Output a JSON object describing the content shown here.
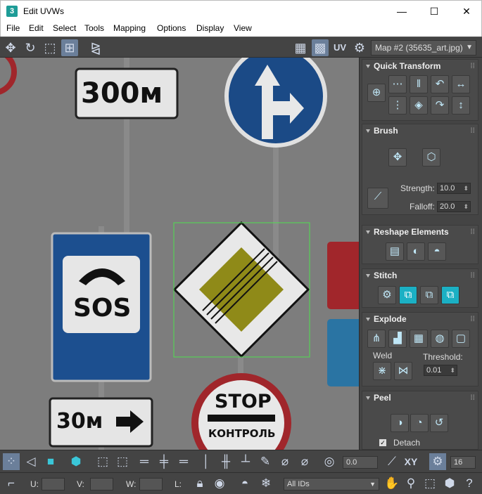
{
  "window": {
    "app_icon": "3",
    "title": "Edit UVWs",
    "minimize": "—",
    "maximize": "☐",
    "close": "✕"
  },
  "menu": [
    "File",
    "Edit",
    "Select",
    "Tools",
    "Mapping",
    "Options",
    "Display",
    "View"
  ],
  "toolbar": {
    "uv_label": "UV",
    "map_dropdown": "Map #2 (35635_art.jpg)"
  },
  "viewport": {
    "sign_300": "300м",
    "sign_sos": "SOS",
    "sign_30": "30м",
    "sign_stop": "STOP",
    "sign_control": "КОНТРОЛЬ"
  },
  "rollouts": {
    "quick_transform": "Quick Transform",
    "brush": "Brush",
    "strength_label": "Strength:",
    "strength_value": "10.0",
    "falloff_label": "Falloff:",
    "falloff_value": "20.0",
    "reshape": "Reshape Elements",
    "stitch": "Stitch",
    "explode": "Explode",
    "weld": "Weld",
    "threshold_label": "Threshold:",
    "threshold_value": "0.01",
    "peel": "Peel",
    "detach": "Detach"
  },
  "bottombar": {
    "value_field": "0.0",
    "xy_label": "XY",
    "count_field": "16",
    "u_label": "U:",
    "v_label": "V:",
    "w_label": "W:",
    "l_label": "L:",
    "ids_dropdown": "All IDs"
  },
  "colors": {
    "accent_cyan": "#1bb0c4",
    "selection_green": "#4ee04e",
    "panel_bg": "#444444",
    "viewport_bg": "#7d7d7d"
  }
}
